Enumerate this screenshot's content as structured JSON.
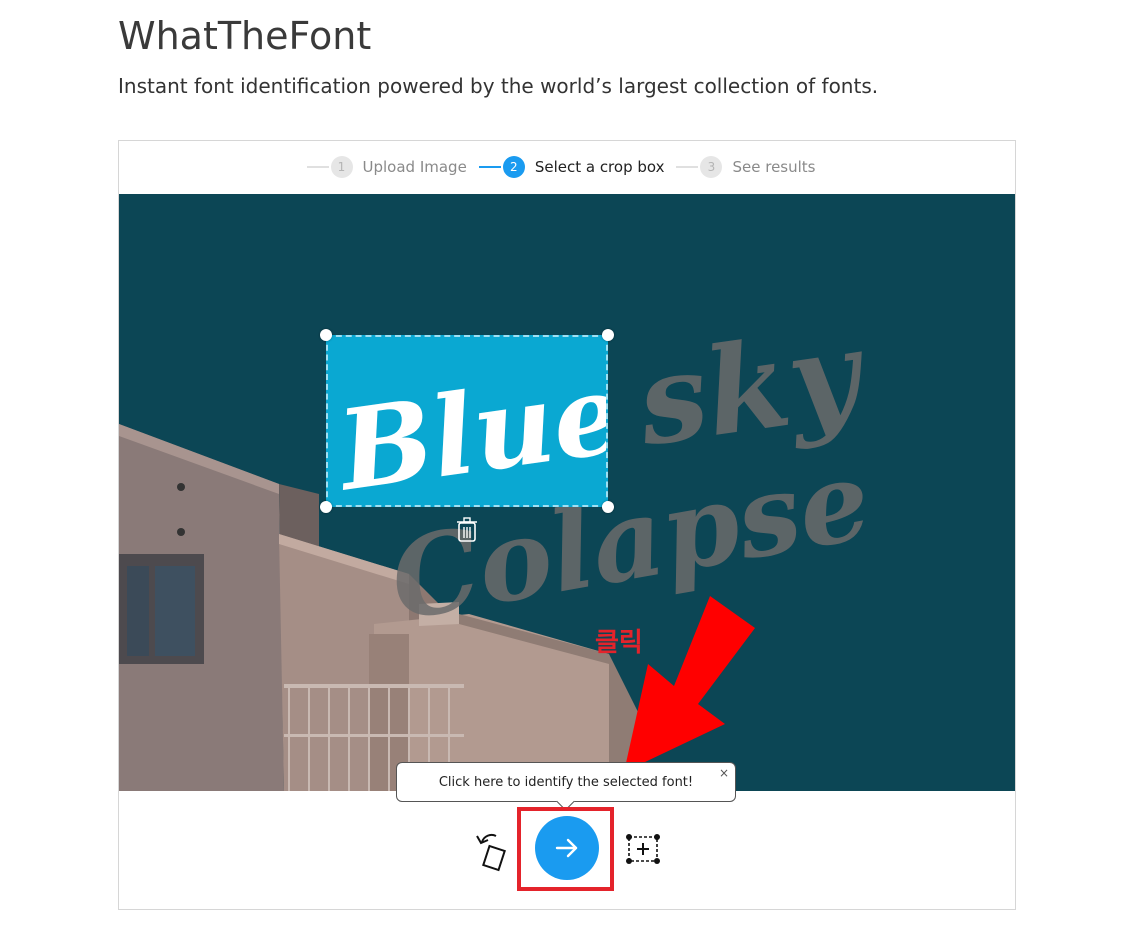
{
  "page": {
    "title": "WhatTheFont",
    "subtitle": "Instant font identification powered by the world’s largest collection of fonts."
  },
  "steps": [
    {
      "number": "1",
      "label": "Upload Image",
      "active": false
    },
    {
      "number": "2",
      "label": "Select a crop box",
      "active": true
    },
    {
      "number": "3",
      "label": "See results",
      "active": false
    }
  ],
  "image": {
    "text_lines": [
      "sky",
      "Colapse"
    ],
    "crop_text": "Blue"
  },
  "tooltip": {
    "text": "Click here to identify the selected font!",
    "close": "×"
  },
  "toolbar": {
    "rotate_icon": "rotate-icon",
    "identify_icon": "arrow-right-icon",
    "add_crop_icon": "add-crop-box-icon"
  },
  "annotation": {
    "label": "클릭",
    "color": "#e4232b"
  },
  "colors": {
    "accent": "#1a9bf0",
    "image_bg": "#0c4655",
    "crop_bg": "#0aa8d2"
  }
}
